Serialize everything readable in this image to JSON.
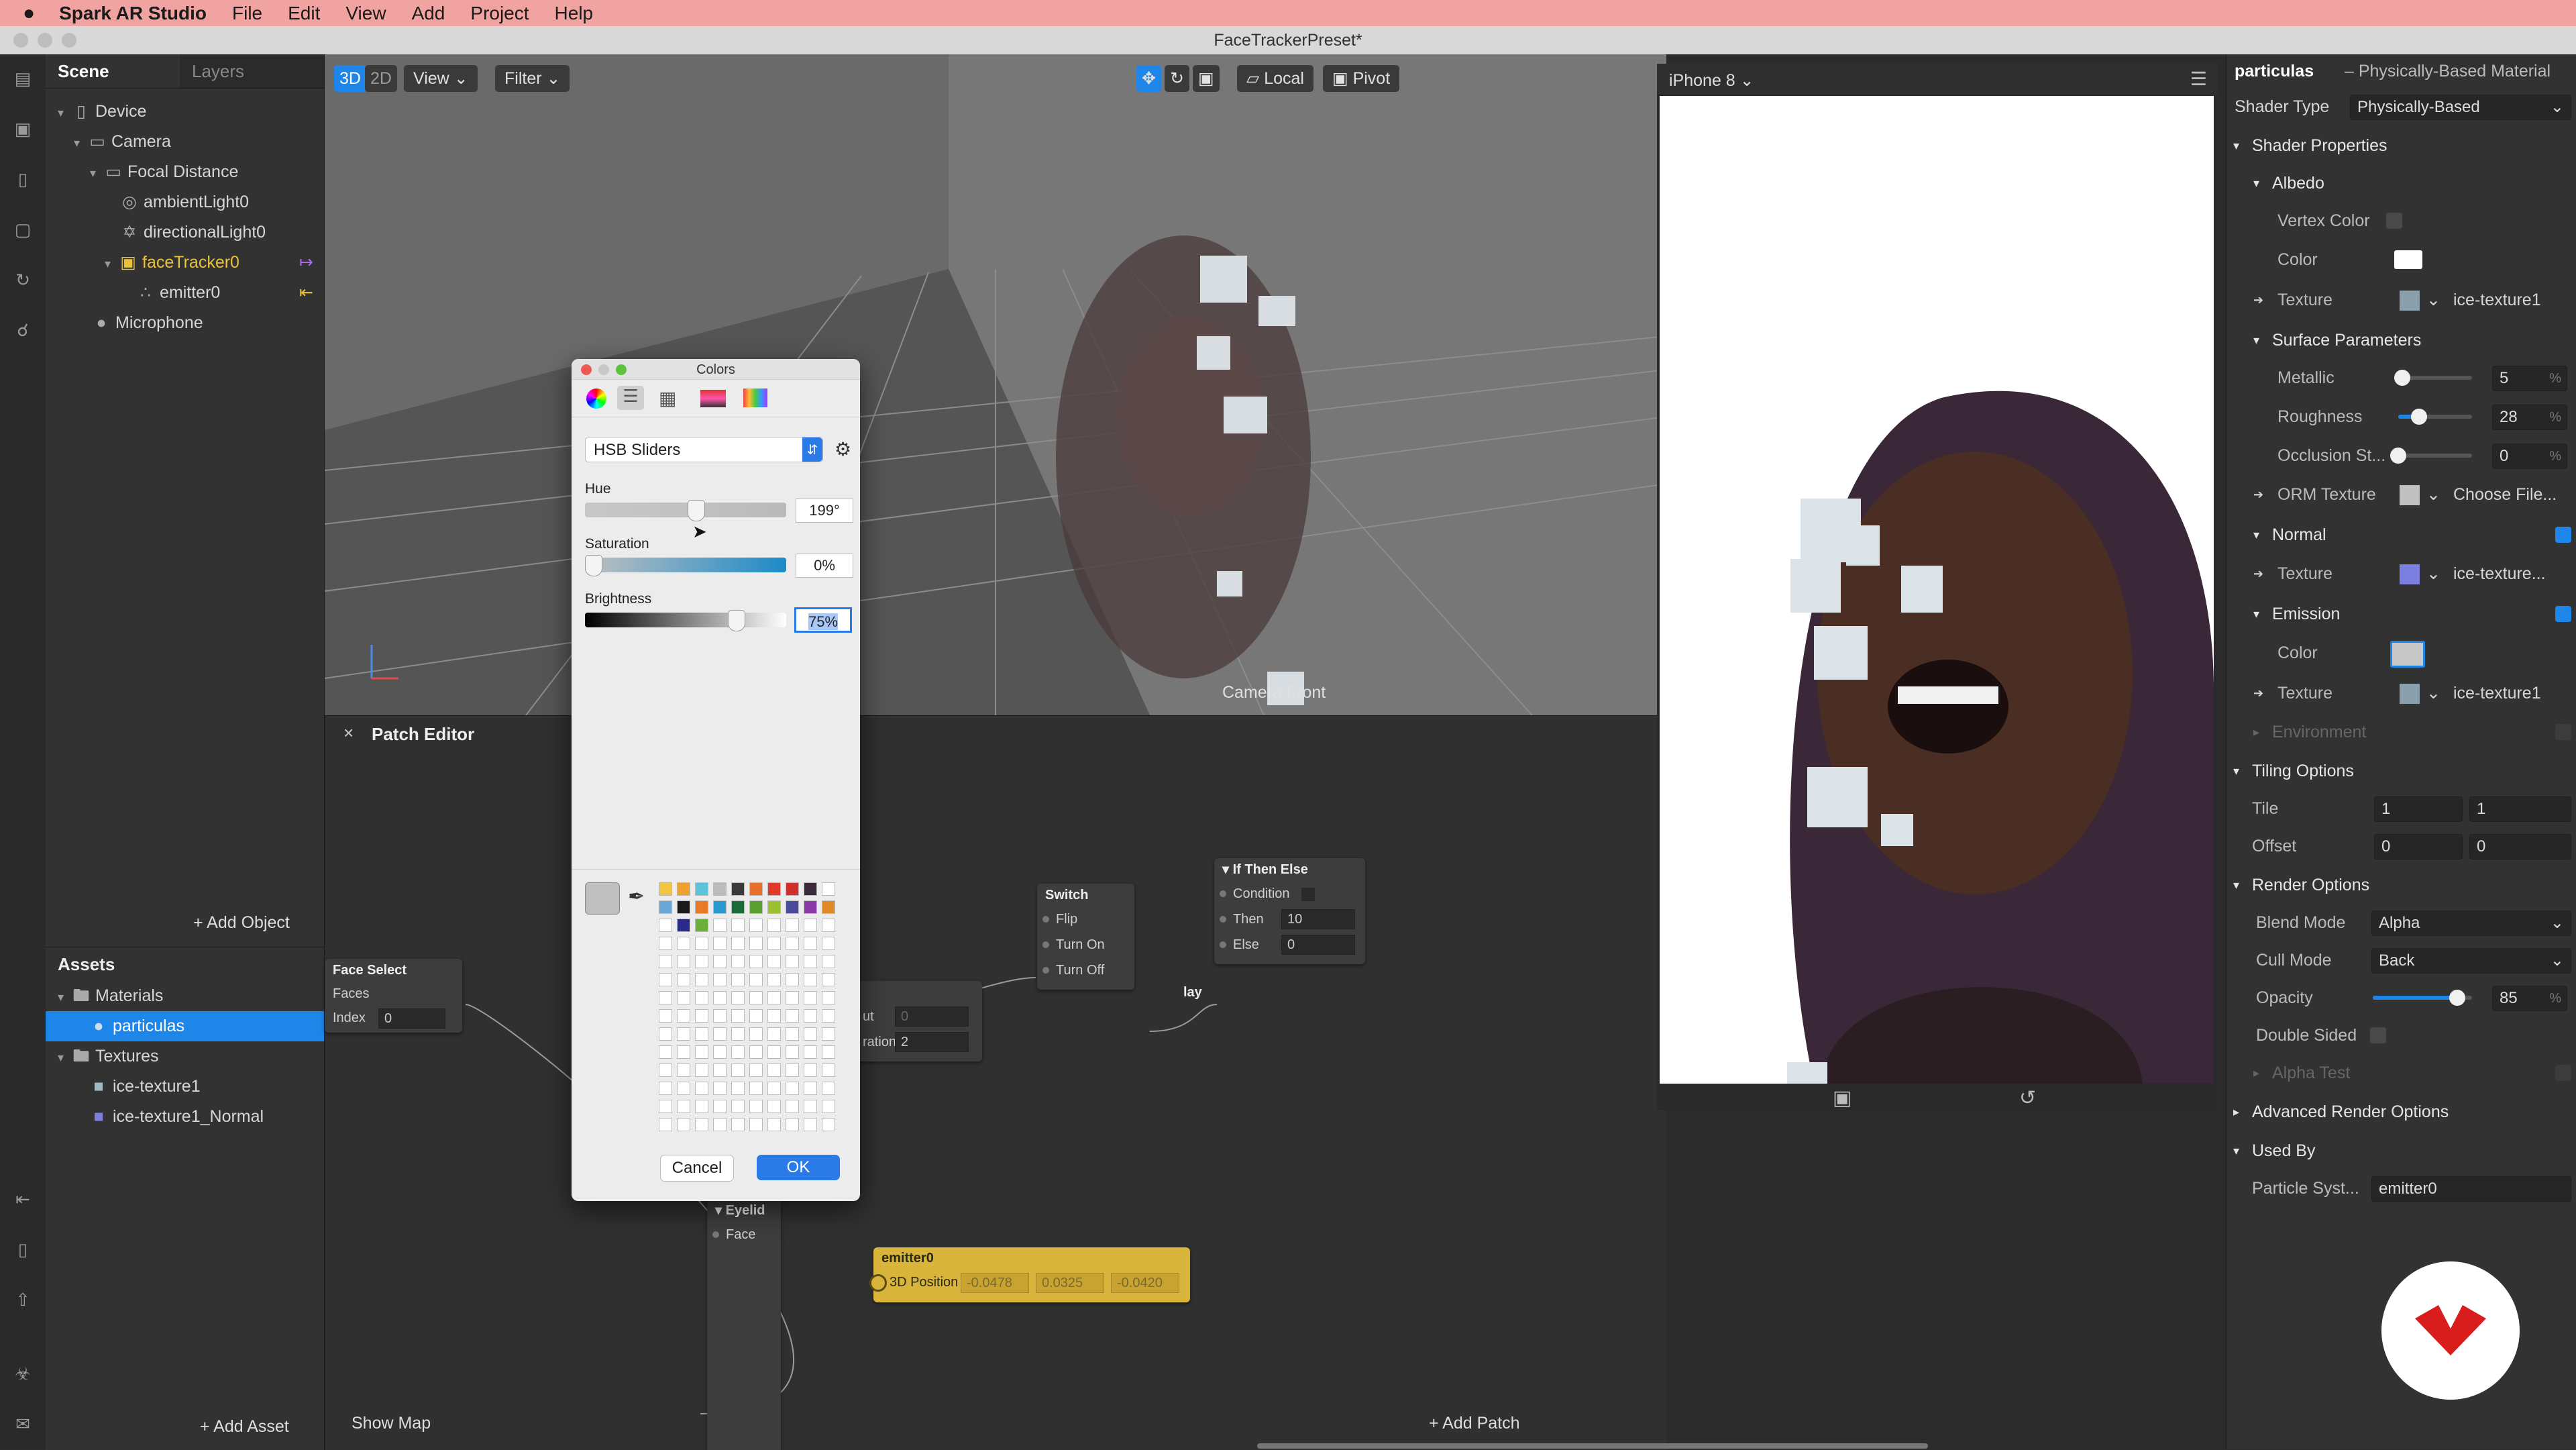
{
  "menubar": {
    "app": "Spark AR Studio",
    "items": [
      "File",
      "Edit",
      "View",
      "Add",
      "Project",
      "Help"
    ]
  },
  "window_title": "FaceTrackerPreset*",
  "scene": {
    "tabs": [
      "Scene",
      "Layers"
    ],
    "tree": [
      {
        "label": "Device",
        "depth": 0,
        "icon": "device-icon"
      },
      {
        "label": "Camera",
        "depth": 1,
        "icon": "camera-icon"
      },
      {
        "label": "Focal Distance",
        "depth": 2,
        "icon": "focal-distance-icon"
      },
      {
        "label": "ambientLight0",
        "depth": 3,
        "icon": "ambient-light-icon"
      },
      {
        "label": "directionalLight0",
        "depth": 3,
        "icon": "directional-light-icon"
      },
      {
        "label": "faceTracker0",
        "depth": 3,
        "icon": "face-tracker-icon"
      },
      {
        "label": "emitter0",
        "depth": 4,
        "icon": "emitter-icon"
      },
      {
        "label": "Microphone",
        "depth": 1,
        "icon": "microphone-icon"
      }
    ],
    "add_object": "+ Add Object"
  },
  "assets": {
    "title": "Assets",
    "materials_label": "Materials",
    "material_items": [
      "particulas"
    ],
    "textures_label": "Textures",
    "texture_items": [
      "ice-texture1",
      "ice-texture1_Normal"
    ],
    "add_asset": "+ Add Asset"
  },
  "viewport": {
    "mode_3d": "3D",
    "mode_2d": "2D",
    "view_label": "View",
    "filter_label": "Filter",
    "local_label": "Local",
    "pivot_label": "Pivot",
    "camera_label": "Camera Front"
  },
  "patch_editor": {
    "title": "Patch Editor",
    "show_map": "Show Map",
    "add_patch": "+ Add Patch",
    "nodes": {
      "face_select": {
        "title": "Face Select",
        "ports": [
          "Faces",
          "Index"
        ],
        "index_value": "0"
      },
      "delay": {
        "title": "lay",
        "ports": [
          "ut",
          "ration"
        ],
        "values": [
          "0",
          "2"
        ]
      },
      "switch": {
        "title": "Switch",
        "ports": [
          "Flip",
          "Turn On",
          "Turn Off"
        ]
      },
      "if_then_else": {
        "title": "If Then Else",
        "ports": [
          "Condition",
          "Then",
          "Else"
        ],
        "values": [
          "10",
          "0"
        ]
      },
      "eyelid": {
        "title": "Eyelid",
        "ports": [
          "Face"
        ]
      },
      "emitter": {
        "title": "emitter0",
        "port": "3D Position",
        "values": [
          "-0.0478",
          "0.0325",
          "-0.0420"
        ]
      }
    }
  },
  "simulator": {
    "device": "iPhone 8"
  },
  "colors_dialog": {
    "title": "Colors",
    "mode": "HSB Sliders",
    "hue_label": "Hue",
    "hue_value": "199°",
    "hue_fraction": 0.55,
    "saturation_label": "Saturation",
    "saturation_value": "0%",
    "saturation_fraction": 0.0,
    "brightness_label": "Brightness",
    "brightness_value": "75%",
    "brightness_fraction": 0.75,
    "cancel": "Cancel",
    "ok": "OK",
    "swatches": [
      "#f2c444",
      "#f0a030",
      "#5cc4d8",
      "#bcbcbc",
      "#3a3a3a",
      "#e8702a",
      "#e03a2a",
      "#d0302a",
      "#3a2a3a",
      "#ffffff",
      "#6aa8d8",
      "#1a1a1a",
      "#e87a28",
      "#2a9ad0",
      "#1a6a3a",
      "#5aa030",
      "#9ac030",
      "#4a4a9a",
      "#8a3aa8",
      "#e08a2a",
      "#ffffff",
      "#2a2a8a",
      "#6ab03a"
    ]
  },
  "inspector": {
    "title": "particulas",
    "subtitle": "– Physically-Based Material",
    "shader_type_label": "Shader Type",
    "shader_type_value": "Physically-Based",
    "shader_properties": "Shader Properties",
    "albedo": "Albedo",
    "vertex_color": "Vertex Color",
    "color_label": "Color",
    "texture_label": "Texture",
    "albedo_texture": "ice-texture1",
    "surface_parameters": "Surface Parameters",
    "metallic_label": "Metallic",
    "metallic_value": "5",
    "metallic_fraction": 0.05,
    "roughness_label": "Roughness",
    "roughness_value": "28",
    "roughness_fraction": 0.28,
    "occlusion_label": "Occlusion St...",
    "occlusion_value": "0",
    "occlusion_fraction": 0.0,
    "orm_texture_label": "ORM Texture",
    "orm_texture_value": "Choose File...",
    "normal_label": "Normal",
    "normal_texture": "ice-texture...",
    "emission_label": "Emission",
    "emission_texture": "ice-texture1",
    "environment_label": "Environment",
    "tiling_options": "Tiling Options",
    "tile_label": "Tile",
    "tile_values": [
      "1",
      "1"
    ],
    "offset_label": "Offset",
    "offset_values": [
      "0",
      "0"
    ],
    "render_options": "Render Options",
    "blend_mode_label": "Blend Mode",
    "blend_mode_value": "Alpha",
    "cull_mode_label": "Cull Mode",
    "cull_mode_value": "Back",
    "opacity_label": "Opacity",
    "opacity_value": "85",
    "opacity_fraction": 0.85,
    "double_sided_label": "Double Sided",
    "alpha_test_label": "Alpha Test",
    "advanced_render_options": "Advanced Render Options",
    "used_by": "Used By",
    "particle_system_label": "Particle Syst...",
    "particle_system_value": "emitter0",
    "percent": "%"
  },
  "colors": {
    "accent": "#1d86e8",
    "menubar": "#f0a3a0",
    "emitter_node": "#d9b43a"
  }
}
